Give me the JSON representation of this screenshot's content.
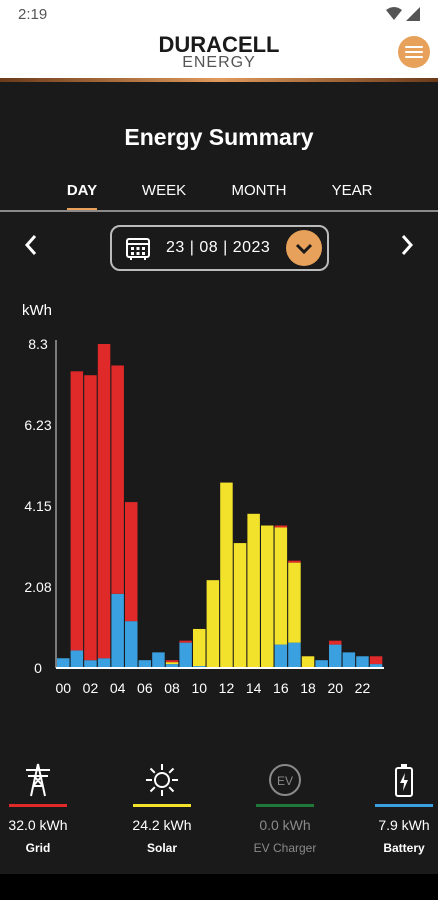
{
  "status_bar": {
    "time": "2:19"
  },
  "header": {
    "brand": "DURACELL",
    "brand_sub": "ENERGY"
  },
  "title": "Energy Summary",
  "tabs": [
    {
      "label": "DAY",
      "active": true
    },
    {
      "label": "WEEK",
      "active": false
    },
    {
      "label": "MONTH",
      "active": false
    },
    {
      "label": "YEAR",
      "active": false
    }
  ],
  "date": {
    "value": "23 | 08 | 2023"
  },
  "chart_data": {
    "type": "bar",
    "stacked": true,
    "ylabel": "kWh",
    "ylim": [
      0,
      8.3
    ],
    "yticks": [
      "0",
      "2.08",
      "4.15",
      "6.23",
      "8.3"
    ],
    "ytick_values": [
      0,
      2.08,
      4.15,
      6.23,
      8.3
    ],
    "xticks": [
      "00",
      "02",
      "04",
      "06",
      "08",
      "10",
      "12",
      "14",
      "16",
      "18",
      "20",
      "22"
    ],
    "x": [
      0,
      1,
      2,
      3,
      4,
      5,
      6,
      7,
      8,
      9,
      10,
      11,
      12,
      13,
      14,
      15,
      16,
      17,
      18,
      19,
      20,
      21,
      22,
      23
    ],
    "series": [
      {
        "key": "battery",
        "color": "#3aa0e0",
        "values": [
          0.25,
          0.45,
          0.2,
          0.25,
          1.9,
          1.2,
          0.2,
          0.4,
          0.1,
          0.65,
          0.05,
          0,
          0,
          0,
          0,
          0,
          0.6,
          0.65,
          0,
          0.2,
          0.6,
          0.4,
          0.3,
          0.1
        ]
      },
      {
        "key": "solar",
        "color": "#f2e22c",
        "values": [
          0,
          0,
          0,
          0,
          0,
          0,
          0,
          0,
          0.05,
          0,
          0.95,
          2.25,
          4.75,
          3.2,
          3.95,
          3.65,
          3.0,
          2.05,
          0.3,
          0,
          0,
          0,
          0,
          0
        ]
      },
      {
        "key": "grid",
        "color": "#e02a2a",
        "values": [
          0,
          7.15,
          7.3,
          8.05,
          5.85,
          3.05,
          0,
          0,
          0.05,
          0.05,
          0,
          0,
          0,
          0,
          0,
          0,
          0.05,
          0.05,
          0,
          0,
          0.1,
          0,
          0,
          0.2
        ]
      }
    ]
  },
  "legend": [
    {
      "key": "grid",
      "icon": "grid-tower-icon",
      "value": "32.0 kWh",
      "label": "Grid",
      "color": "#e02a2a"
    },
    {
      "key": "solar",
      "icon": "sun-icon",
      "value": "24.2 kWh",
      "label": "Solar",
      "color": "#f2e22c"
    },
    {
      "key": "ev",
      "icon": "ev-charger-icon",
      "value": "0.0 kWh",
      "label": "EV Charger",
      "color": "#1f7a3a"
    },
    {
      "key": "battery",
      "icon": "battery-icon",
      "value": "7.9 kWh",
      "label": "Battery",
      "color": "#3aa0e0"
    }
  ]
}
